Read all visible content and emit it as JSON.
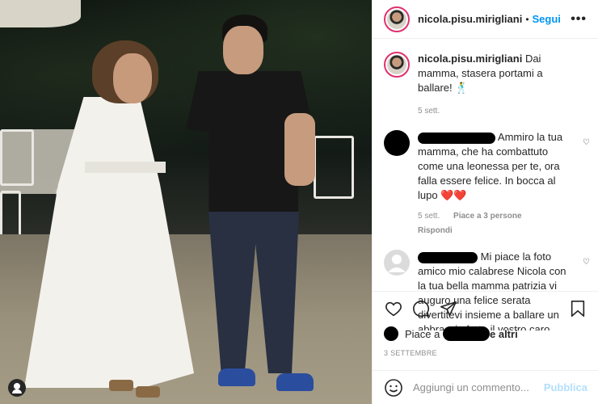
{
  "post": {
    "username": "nicola.pisu.mirigliani",
    "follow_label": "Segui",
    "more_label": "•••",
    "caption_text": "Dai mamma, stasera portami a ballare!",
    "caption_emoji": "🕺",
    "caption_time": "5 sett."
  },
  "comments": [
    {
      "text": "Ammiro la tua mamma, che ha combattuto come una leonessa per te, ora falla essere felice. In bocca al lupo",
      "hearts": "❤️❤️",
      "time": "5 sett.",
      "likes": "Piace a 3 persone",
      "reply": "Rispondi"
    },
    {
      "text": "Mi piace la foto amico mio calabrese Nicola con la tua bella mamma patrizia vi auguro una felice serata divertitevi insieme a ballare un abbraccio forte il vostro caro amico fans calabrese ok ciao.... 👏",
      "emojis": "👏👏👏👏👍👍👍👍👍👍🙌🙌"
    }
  ],
  "likes": {
    "prefix": "Piace a",
    "suffix": "e altri"
  },
  "date": "3 SETTEMBRE",
  "add_comment": {
    "placeholder": "Aggiungi un commento...",
    "publish": "Pubblica"
  },
  "icons": [
    "heart-icon",
    "comment-icon",
    "share-icon",
    "bookmark-icon",
    "emoji-icon",
    "more-icon",
    "user-tag-icon"
  ],
  "colors": {
    "follow": "#0095f6",
    "publish_disabled": "#b2dffc",
    "heart": "#ed4956",
    "muted": "#8e8e8e"
  }
}
